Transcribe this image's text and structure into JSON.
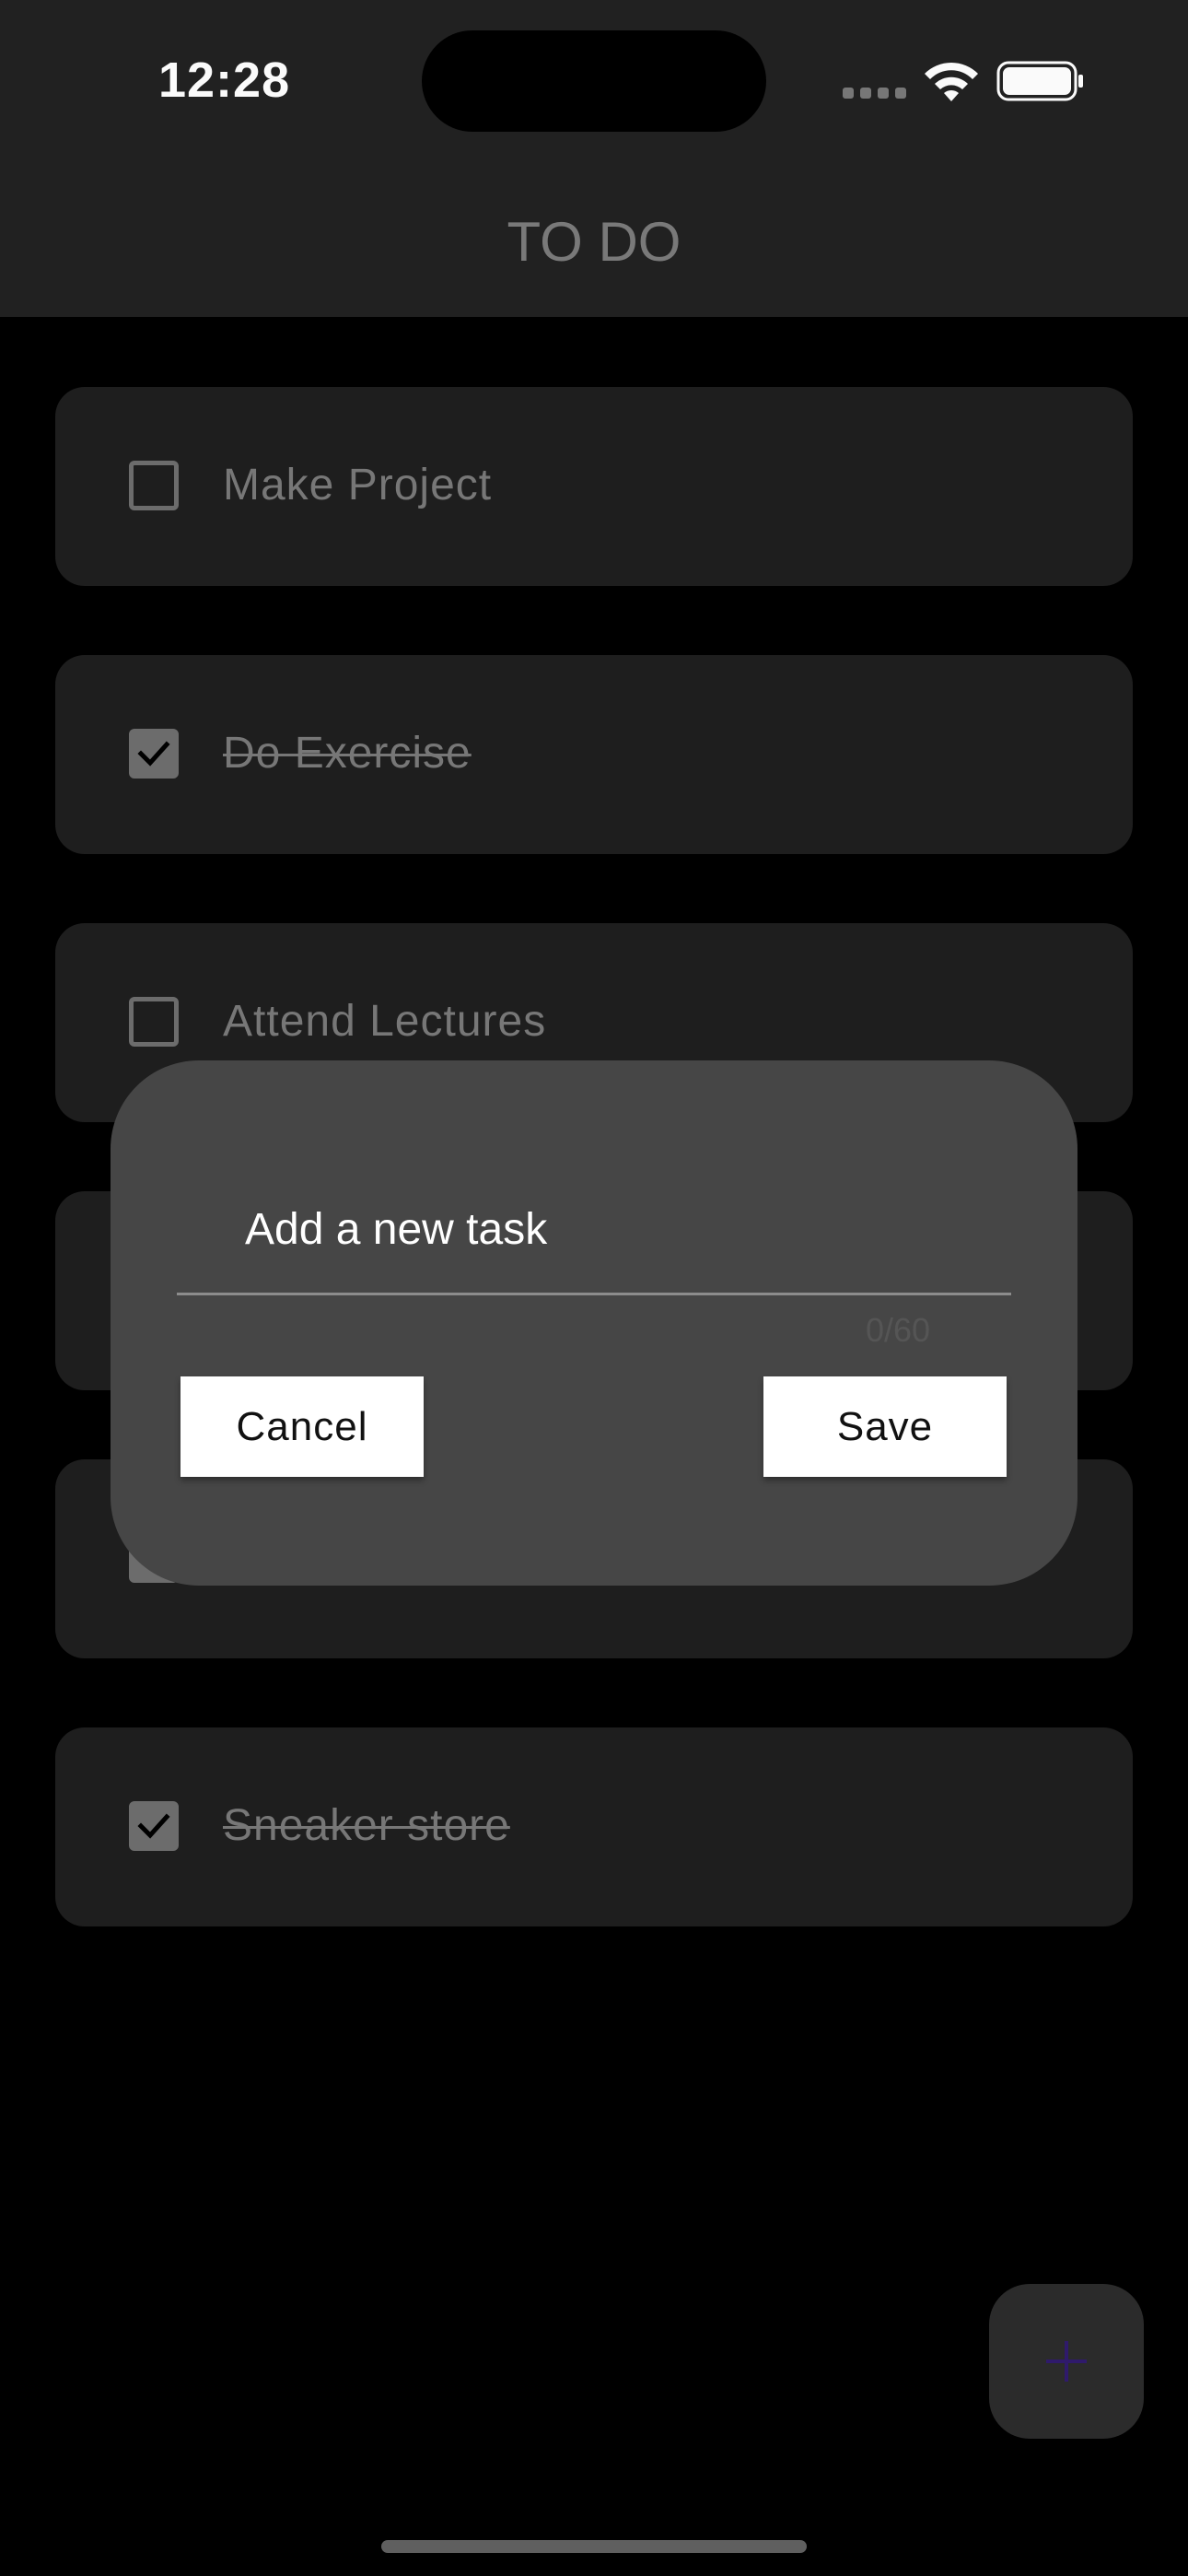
{
  "status_bar": {
    "time": "12:28"
  },
  "header": {
    "title": "TO DO"
  },
  "tasks": [
    {
      "label": "Make Project",
      "completed": false
    },
    {
      "label": "Do Exercise",
      "completed": true
    },
    {
      "label": "Attend Lectures",
      "completed": false
    },
    {
      "label": "",
      "completed": false
    },
    {
      "label": "",
      "completed": true
    },
    {
      "label": "Sneaker store",
      "completed": true
    }
  ],
  "dialog": {
    "input_placeholder": "Add a new task",
    "input_value": "",
    "char_counter": "0/60",
    "cancel_label": "Cancel",
    "save_label": "Save"
  },
  "fab": {
    "icon": "plus-icon"
  },
  "colors": {
    "background": "#000000",
    "app_bar": "#222222",
    "card": "#1f1f1f",
    "dialog": "#464646",
    "fab_icon": "#2f1a6b"
  }
}
